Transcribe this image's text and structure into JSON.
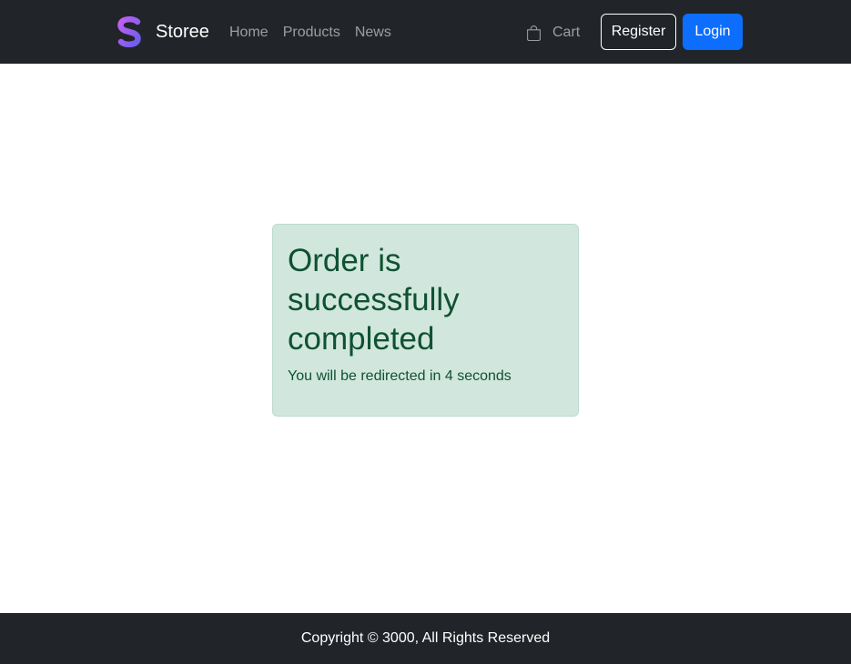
{
  "navbar": {
    "brand_name": "Storee",
    "logo_icon": "s-logo-icon",
    "links": [
      {
        "label": "Home"
      },
      {
        "label": "Products"
      },
      {
        "label": "News"
      }
    ],
    "cart": {
      "icon": "bag-icon",
      "label": "Cart"
    },
    "register_label": "Register",
    "login_label": "Login"
  },
  "alert": {
    "title": "Order is successfully completed",
    "message": "You will be redirected in 4 seconds"
  },
  "footer": {
    "copyright": "Copyright © 3000, All Rights Reserved"
  },
  "colors": {
    "navbar_bg": "#212529",
    "primary": "#0d6efd",
    "alert_bg": "#d1e7dd",
    "alert_text": "#0f5132",
    "logo_gradient": [
      "#b15df0",
      "#5d6ff0"
    ]
  }
}
